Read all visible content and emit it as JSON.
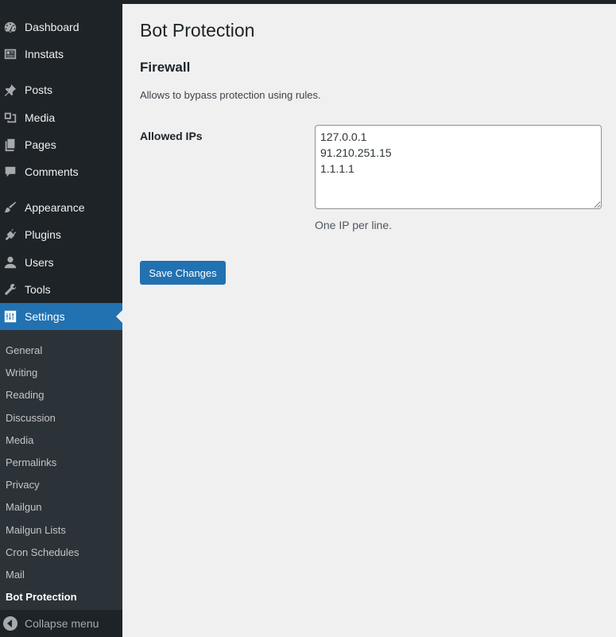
{
  "sidebar": {
    "items": [
      {
        "label": "Dashboard",
        "icon": "dashboard-icon"
      },
      {
        "label": "Innstats",
        "icon": "innstats-icon"
      },
      {
        "label": "Posts",
        "icon": "pin-icon"
      },
      {
        "label": "Media",
        "icon": "media-icon"
      },
      {
        "label": "Pages",
        "icon": "pages-icon"
      },
      {
        "label": "Comments",
        "icon": "comment-icon"
      },
      {
        "label": "Appearance",
        "icon": "brush-icon"
      },
      {
        "label": "Plugins",
        "icon": "plugin-icon"
      },
      {
        "label": "Users",
        "icon": "user-icon"
      },
      {
        "label": "Tools",
        "icon": "wrench-icon"
      },
      {
        "label": "Settings",
        "icon": "settings-icon",
        "active": true
      }
    ],
    "submenu": [
      {
        "label": "General"
      },
      {
        "label": "Writing"
      },
      {
        "label": "Reading"
      },
      {
        "label": "Discussion"
      },
      {
        "label": "Media"
      },
      {
        "label": "Permalinks"
      },
      {
        "label": "Privacy"
      },
      {
        "label": "Mailgun"
      },
      {
        "label": "Mailgun Lists"
      },
      {
        "label": "Cron Schedules"
      },
      {
        "label": "Mail"
      },
      {
        "label": "Bot Protection",
        "current": true
      }
    ],
    "collapse_label": "Collapse menu"
  },
  "main": {
    "page_title": "Bot Protection",
    "section_title": "Firewall",
    "section_description": "Allows to bypass protection using rules.",
    "allowed_ips_label": "Allowed IPs",
    "allowed_ips_value": "127.0.0.1\n91.210.251.15\n1.1.1.1",
    "allowed_ips_hint": "One IP per line.",
    "save_label": "Save Changes"
  },
  "colors": {
    "admin_bar": "#1d2327",
    "sidebar_bg": "#1d2327",
    "submenu_bg": "#2c3338",
    "accent": "#2271b1",
    "content_bg": "#f0f0f1"
  }
}
